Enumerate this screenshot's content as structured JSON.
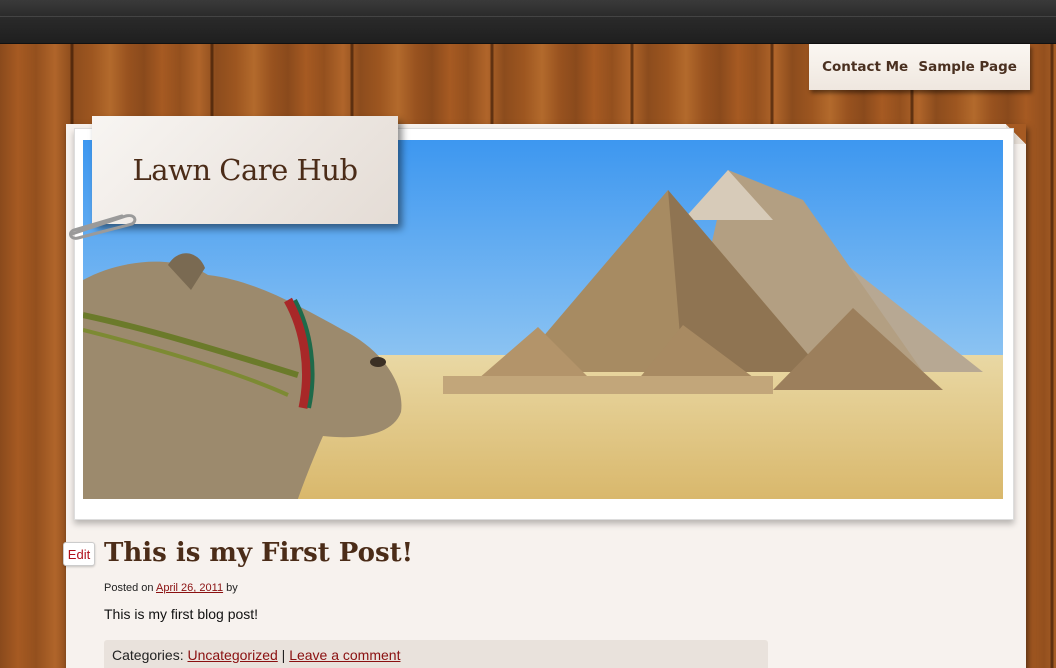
{
  "nav": {
    "items": [
      "Contact Me",
      "Sample Page"
    ]
  },
  "site": {
    "title": "Lawn Care Hub"
  },
  "post": {
    "edit_label": "Edit",
    "title": "This is my First Post!",
    "posted_on": "Posted on",
    "date": "April 26, 2011",
    "by": "by",
    "body": "This is my first blog post!",
    "categories_label": "Categories:",
    "category": "Uncategorized",
    "separator": "|",
    "comment_link": "Leave a comment"
  },
  "colors": {
    "topbar": "#2a2a2a",
    "wood": "#a65a22",
    "title_text": "#4b2c18",
    "link": "#8a1010",
    "edit_red": "#b0101a"
  }
}
